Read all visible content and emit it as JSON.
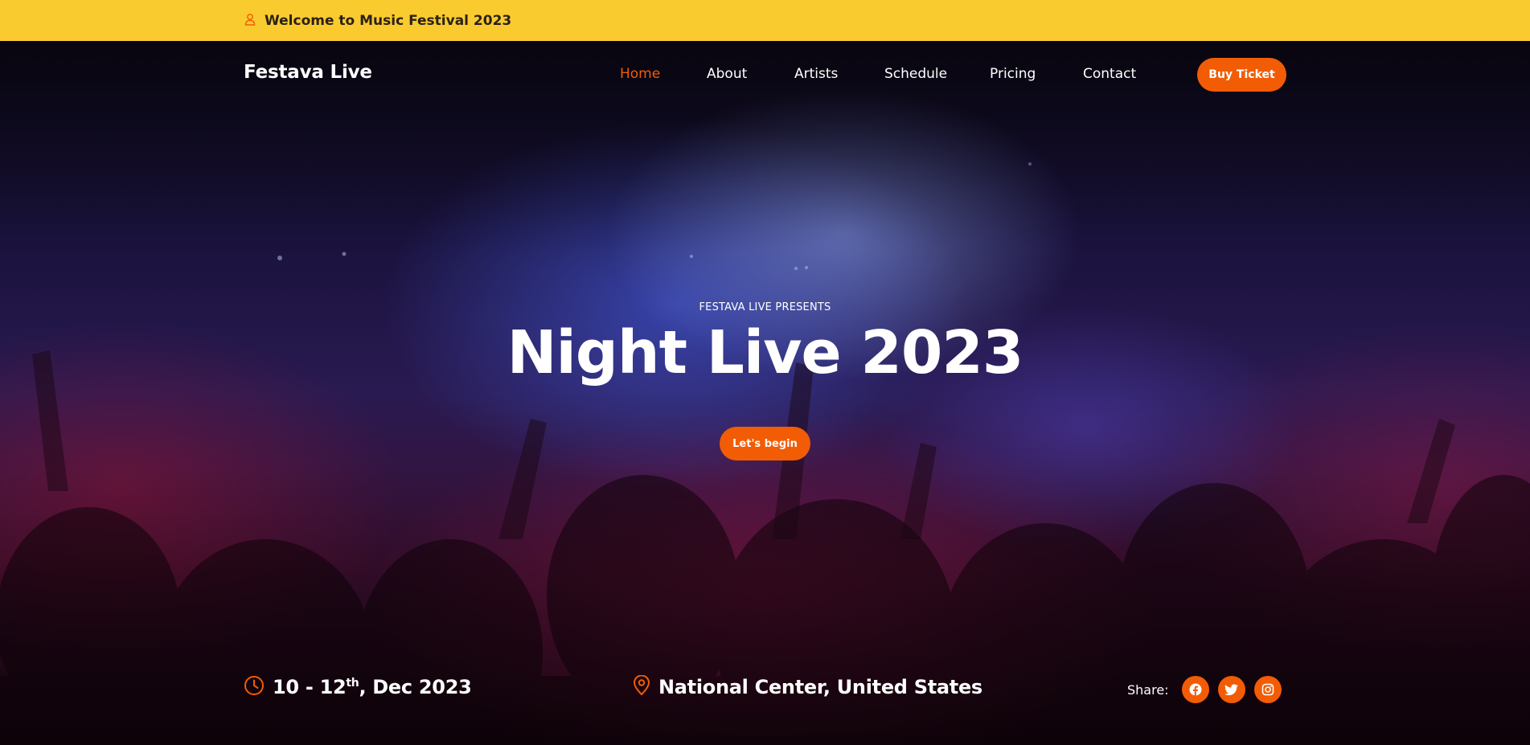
{
  "topbar": {
    "icon": "user-icon",
    "text": "Welcome to Music Festival 2023"
  },
  "nav": {
    "brand": "Festava Live",
    "items": [
      {
        "label": "Home",
        "active": true
      },
      {
        "label": "About",
        "active": false
      },
      {
        "label": "Artists",
        "active": false
      },
      {
        "label": "Schedule",
        "active": false
      },
      {
        "label": "Pricing",
        "active": false
      },
      {
        "label": "Contact",
        "active": false
      }
    ],
    "cta": "Buy Ticket"
  },
  "hero": {
    "presents": "FESTAVA LIVE PRESENTS",
    "title": "Night Live 2023",
    "cta": "Let's begin"
  },
  "details": {
    "date_main": "10 - 12",
    "date_sup": "th",
    "date_rest": ", Dec 2023",
    "date_icon": "clock-icon",
    "location": "National Center, United States",
    "location_icon": "map-pin-icon",
    "share_label": "Share:",
    "social": [
      "facebook-icon",
      "twitter-icon",
      "instagram-icon"
    ]
  },
  "colors": {
    "accent": "#f25c05",
    "topbar": "#f9cb2f",
    "topbar_text": "#2b2118",
    "text": "#ffffff"
  }
}
